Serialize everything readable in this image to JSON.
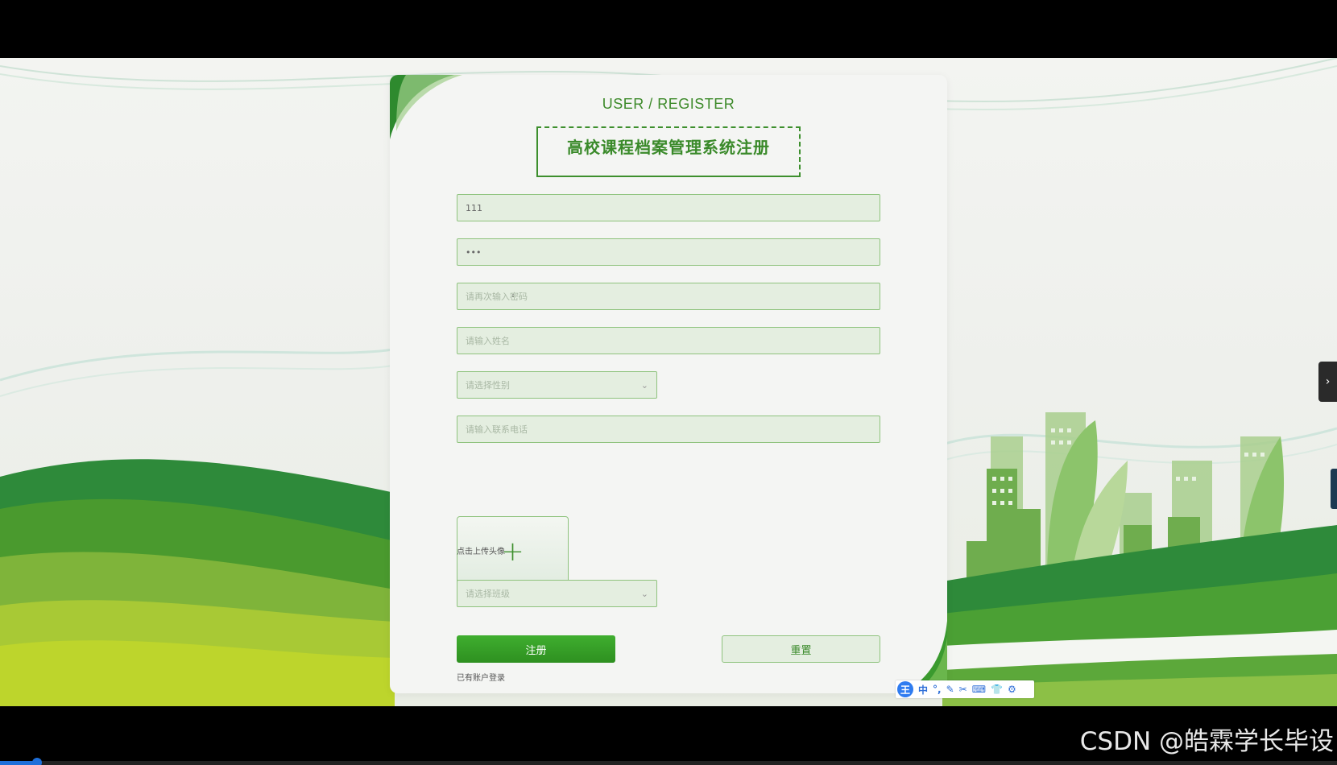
{
  "card": {
    "subtitle": "USER / REGISTER",
    "title": "高校课程档案管理系统注册"
  },
  "form": {
    "account_value": "111",
    "password_value": "•••",
    "confirm_password_placeholder": "请再次输入密码",
    "name_placeholder": "请输入姓名",
    "gender_placeholder": "请选择性别",
    "phone_placeholder": "请输入联系电话",
    "avatar_hint": "点击上传头像",
    "class_placeholder": "请选择班级",
    "register_label": "注册",
    "reset_label": "重置",
    "login_link": "已有账户登录"
  },
  "ime_toolbar": {
    "logo": "王",
    "items": [
      "中",
      "°,",
      "✎",
      "✂",
      "⌨",
      "👕",
      "⚙"
    ]
  },
  "watermark": "CSDN @皓霖学长毕设",
  "video_progress": 0.028,
  "colors": {
    "primary_green": "#3a8a2a",
    "field_bg": "#e4eee0",
    "field_border": "#8fc37e"
  }
}
